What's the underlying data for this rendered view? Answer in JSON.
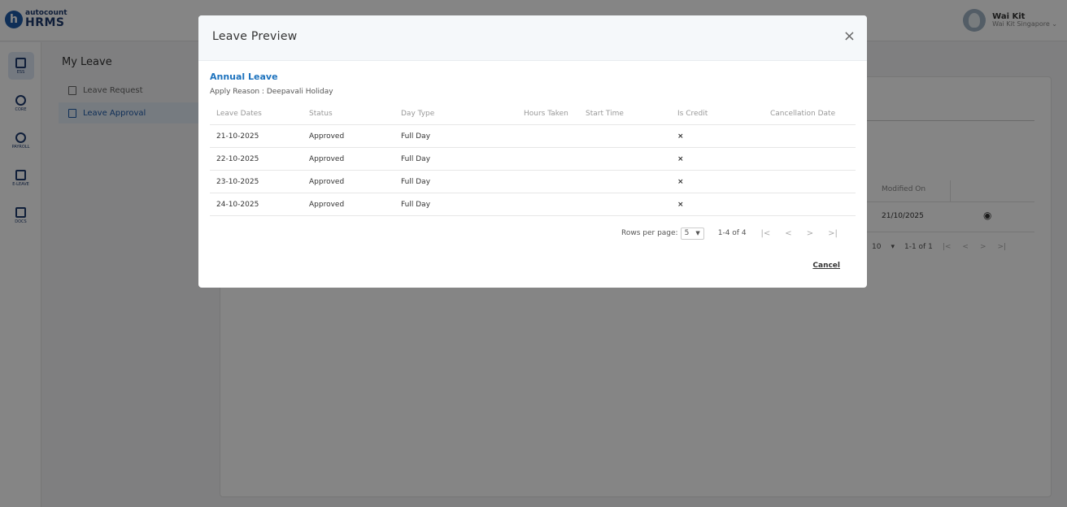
{
  "brand": {
    "logo_letter": "h",
    "top": "autocount",
    "bottom": "HRMS"
  },
  "user": {
    "name": "Wai Kit",
    "org": "Wai Kit Singapore ⌄"
  },
  "sidenav": [
    {
      "label": "ESS",
      "icon": "ess-icon"
    },
    {
      "label": "CORE",
      "icon": "core-icon"
    },
    {
      "label": "PAYROLL",
      "icon": "payroll-icon"
    },
    {
      "label": "E-LEAVE",
      "icon": "calendar-icon"
    },
    {
      "label": "DOCS",
      "icon": "docs-icon"
    }
  ],
  "subnav": {
    "title": "My Leave",
    "items": [
      {
        "label": "Leave Request",
        "icon": "document-icon"
      },
      {
        "label": "Leave Approval",
        "icon": "document-icon"
      }
    ]
  },
  "background_table": {
    "header": "Modified On",
    "cell": "21/10/2025",
    "rows_per_page": "10",
    "range": "1-1 of 1"
  },
  "modal": {
    "title": "Leave Preview",
    "close": "×",
    "leave_type": "Annual Leave",
    "apply_reason": "Apply Reason : Deepavali Holiday",
    "columns": [
      "Leave Dates",
      "Status",
      "Day Type",
      "Hours Taken",
      "Start Time",
      "Is Credit",
      "Cancellation Date"
    ],
    "rows": [
      {
        "date": "21-10-2025",
        "status": "Approved",
        "day_type": "Full Day",
        "is_credit": "×"
      },
      {
        "date": "22-10-2025",
        "status": "Approved",
        "day_type": "Full Day",
        "is_credit": "×"
      },
      {
        "date": "23-10-2025",
        "status": "Approved",
        "day_type": "Full Day",
        "is_credit": "×"
      },
      {
        "date": "24-10-2025",
        "status": "Approved",
        "day_type": "Full Day",
        "is_credit": "×"
      }
    ],
    "pagination": {
      "rows_per_page_label": "Rows per page:",
      "rows_per_page": "5",
      "range": "1-4 of 4",
      "first": "|<",
      "prev": "<",
      "next": ">",
      "last": ">|"
    },
    "cancel_label": "Cancel"
  },
  "colors": {
    "accent": "#1e73be",
    "brand": "#1e3a6e",
    "error": "#e0312f"
  }
}
